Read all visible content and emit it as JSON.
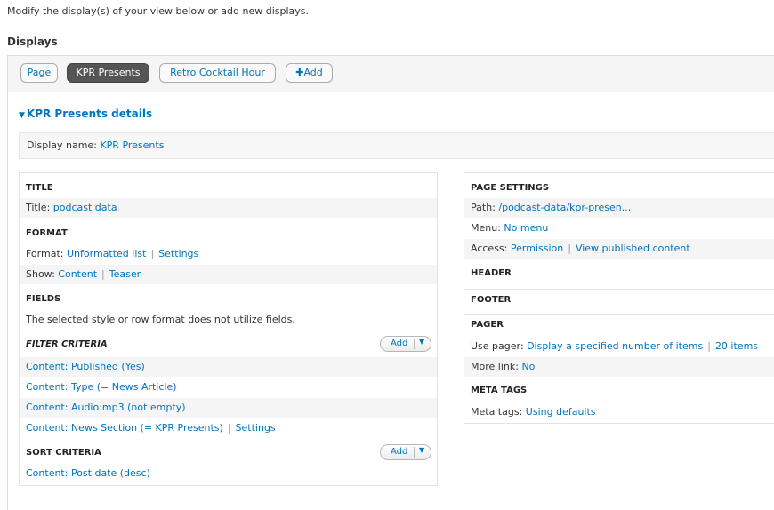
{
  "intro": "Modify the display(s) of your view below or add new displays.",
  "displays_heading": "Displays",
  "tabs": {
    "page": "Page",
    "kpr": "KPR Presents",
    "retro": "Retro Cocktail Hour",
    "add": "Add"
  },
  "details_title": "KPR Presents details",
  "display_name": {
    "label": "Display name:",
    "value": "KPR Presents"
  },
  "left": {
    "title_section": "TITLE",
    "title_label": "Title:",
    "title_value": "podcast data",
    "format_section": "FORMAT",
    "format_label": "Format:",
    "format_value": "Unformatted list",
    "format_settings": "Settings",
    "show_label": "Show:",
    "show_value": "Content",
    "show_teaser": "Teaser",
    "fields_section": "FIELDS",
    "fields_note": "The selected style or row format does not utilize fields.",
    "filter_section": "FILTER CRITERIA",
    "filter_add": "Add",
    "filters": [
      "Content: Published (Yes)",
      "Content: Type (= News Article)",
      "Content: Audio:mp3 (not empty)",
      "Content: News Section (= KPR Presents)"
    ],
    "filter_settings": "Settings",
    "sort_section": "SORT CRITERIA",
    "sort_add": "Add",
    "sort_item": "Content: Post date (desc)"
  },
  "right": {
    "page_settings_section": "PAGE SETTINGS",
    "path_label": "Path:",
    "path_value": "/podcast-data/kpr-presen...",
    "menu_label": "Menu:",
    "menu_value": "No menu",
    "access_label": "Access:",
    "access_value": "Permission",
    "access_view": "View published content",
    "header_section": "HEADER",
    "footer_section": "FOOTER",
    "pager_section": "PAGER",
    "use_pager_label": "Use pager:",
    "use_pager_value": "Display a specified number of items",
    "use_pager_items": "20 items",
    "more_link_label": "More link:",
    "more_link_value": "No",
    "meta_section": "META TAGS",
    "meta_label": "Meta tags:",
    "meta_value": "Using defaults"
  },
  "separator": "|"
}
